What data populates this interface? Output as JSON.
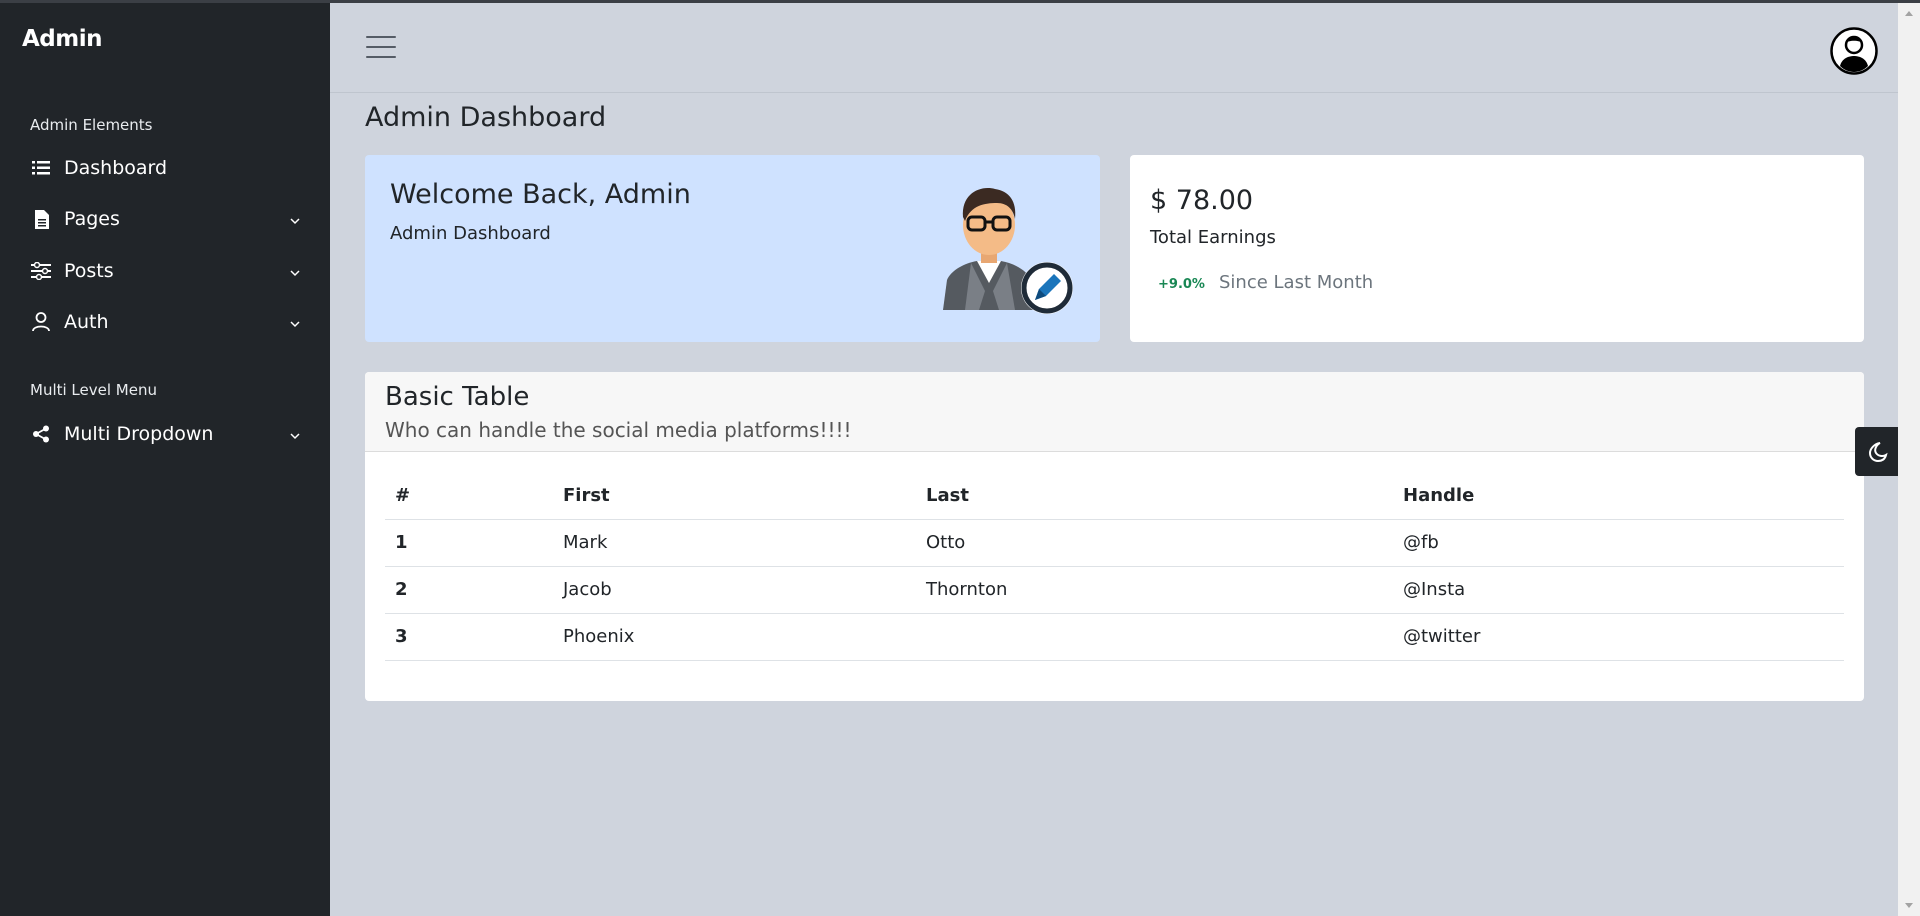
{
  "sidebar": {
    "brand": "Admin",
    "sections": [
      {
        "label": "Admin Elements"
      },
      {
        "label": "Multi Level Menu"
      }
    ],
    "items": [
      {
        "label": "Dashboard",
        "icon": "list-icon",
        "has_dropdown": false
      },
      {
        "label": "Pages",
        "icon": "file-icon",
        "has_dropdown": true
      },
      {
        "label": "Posts",
        "icon": "sliders-icon",
        "has_dropdown": true
      },
      {
        "label": "Auth",
        "icon": "user-icon",
        "has_dropdown": true
      },
      {
        "label": "Multi Dropdown",
        "icon": "share-icon",
        "has_dropdown": true
      }
    ]
  },
  "header": {
    "menu_icon": "hamburger-icon",
    "avatar_icon": "user-avatar-icon"
  },
  "main": {
    "page_title": "Admin Dashboard",
    "welcome_card": {
      "title": "Welcome Back, Admin",
      "subtitle": "Admin Dashboard",
      "illustration": "admin-illustration"
    },
    "earnings_card": {
      "amount": "$ 78.00",
      "label": "Total Earnings",
      "badge": "+9.0%",
      "since": "Since Last Month"
    },
    "table_card": {
      "title": "Basic Table",
      "subtitle": "Who can handle the social media platforms!!!!",
      "columns": [
        "#",
        "First",
        "Last",
        "Handle"
      ],
      "rows": [
        [
          "1",
          "Mark",
          "Otto",
          "@fb"
        ],
        [
          "2",
          "Jacob",
          "Thornton",
          "@Insta"
        ],
        [
          "3",
          "Phoenix",
          "",
          "@twitter"
        ]
      ]
    }
  },
  "theme_toggle": {
    "icon": "moon-icon"
  },
  "colors": {
    "sidebar_bg": "#212529",
    "page_bg": "#cfd4dd",
    "welcome_bg": "#cfe2ff",
    "badge_green": "#198754"
  }
}
